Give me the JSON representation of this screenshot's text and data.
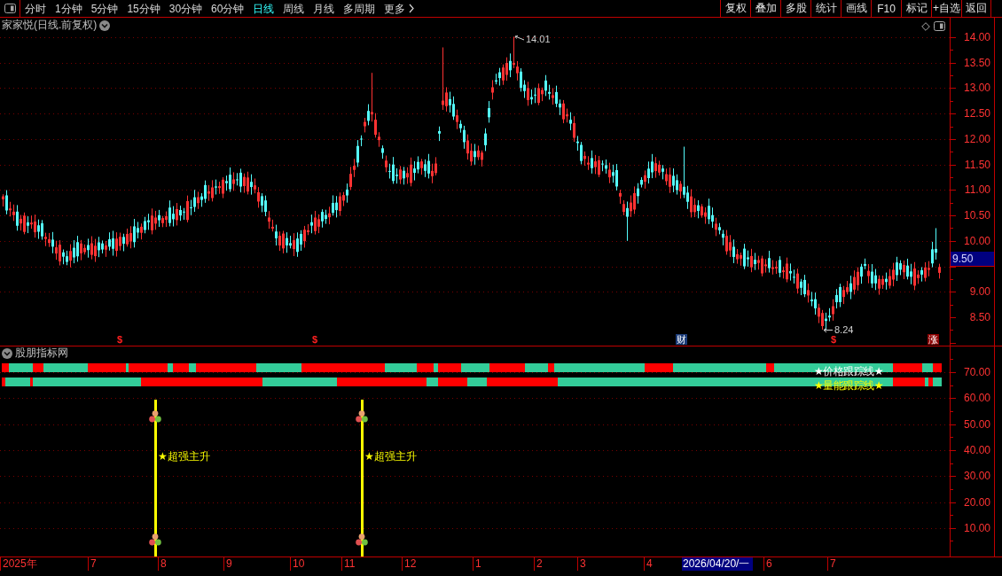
{
  "toolbar": {
    "periods": [
      {
        "label": "分时",
        "kind": "period",
        "selected": false
      },
      {
        "label": "1分钟",
        "kind": "period",
        "selected": false
      },
      {
        "label": "5分钟",
        "kind": "period",
        "selected": false
      },
      {
        "label": "15分钟",
        "kind": "period",
        "selected": false
      },
      {
        "label": "30分钟",
        "kind": "period",
        "selected": false
      },
      {
        "label": "60分钟",
        "kind": "period",
        "selected": false
      },
      {
        "label": "日线",
        "kind": "period",
        "selected": true
      },
      {
        "label": "周线",
        "kind": "period",
        "selected": false
      },
      {
        "label": "月线",
        "kind": "period",
        "selected": false
      },
      {
        "label": "多周期",
        "kind": "period",
        "selected": false
      },
      {
        "label": "更多",
        "kind": "menu",
        "selected": false
      }
    ],
    "buttons": [
      "复权",
      "叠加",
      "多股",
      "统计",
      "画线",
      "F10",
      "标记",
      "+自选",
      "返回"
    ]
  },
  "price_chart": {
    "title": "家家悦(日线.前复权)",
    "high_label": "14.01",
    "low_label": "8.24",
    "event_markers": [
      {
        "kind": "ex-rights",
        "text": "$"
      },
      {
        "kind": "ex-rights",
        "text": "$"
      },
      {
        "kind": "finance",
        "text": "财"
      },
      {
        "kind": "ex-rights",
        "text": "$"
      },
      {
        "kind": "limit-up",
        "text": "涨"
      }
    ],
    "y_axis_labels": [
      "14.00",
      "13.50",
      "13.00",
      "12.50",
      "12.00",
      "11.50",
      "11.00",
      "10.50",
      "10.00",
      "9.00",
      "8.50"
    ],
    "current_price": "9.50"
  },
  "indicator_panel": {
    "title": "股朋指标网",
    "strip_legends": [
      "★价格跟踪线★",
      "★量能跟踪线★"
    ],
    "signals": [
      {
        "label": "★超强主升"
      },
      {
        "label": "★超强主升"
      }
    ],
    "y_axis_labels": [
      "70.00",
      "60.00",
      "50.00",
      "40.00",
      "30.00",
      "20.00",
      "10.00"
    ]
  },
  "time_axis": {
    "labels": [
      "2025年",
      "7",
      "8",
      "9",
      "10",
      "11",
      "12",
      "1",
      "2",
      "3",
      "4",
      "6",
      "7"
    ],
    "cursor_date": "2026/04/20/一"
  }
}
